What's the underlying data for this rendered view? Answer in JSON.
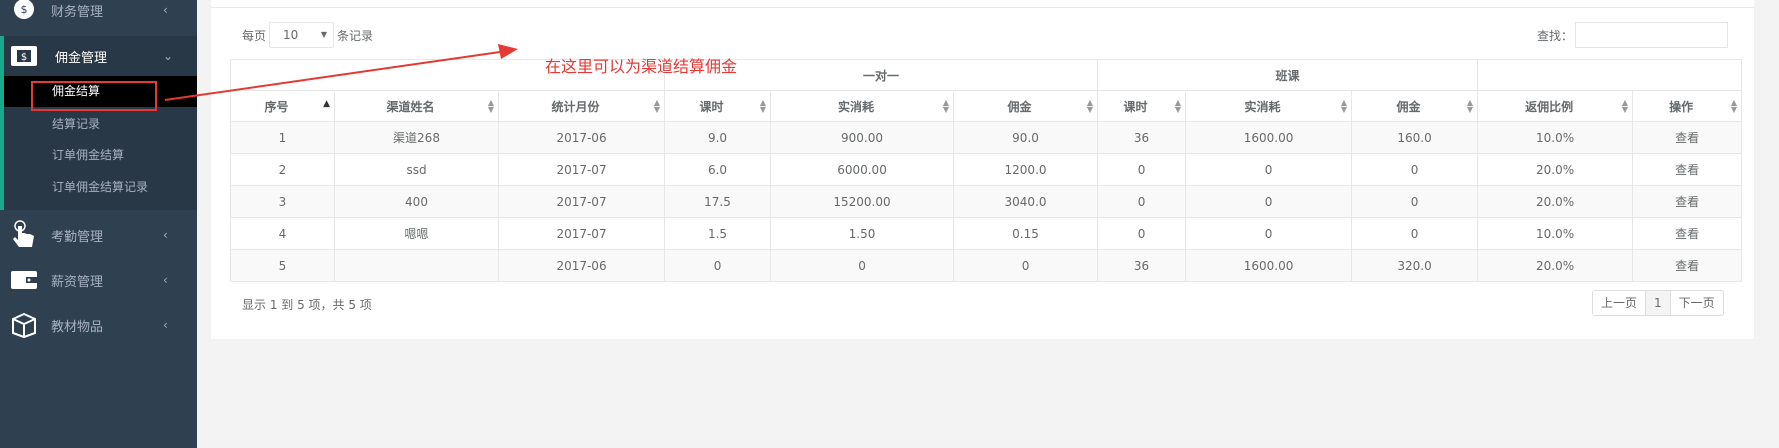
{
  "sidebar": {
    "items": [
      {
        "label": "财务管理",
        "icon": "money-bag-icon",
        "chevron": "‹"
      },
      {
        "label": "佣金管理",
        "icon": "dollar-card-icon",
        "chevron": "⌄"
      },
      {
        "label": "考勤管理",
        "icon": "hand-pointer-icon",
        "chevron": "‹"
      },
      {
        "label": "薪资管理",
        "icon": "wallet-icon",
        "chevron": "‹"
      },
      {
        "label": "教材物品",
        "icon": "package-icon",
        "chevron": "‹"
      }
    ],
    "submenu": [
      {
        "label": "佣金结算"
      },
      {
        "label": "结算记录"
      },
      {
        "label": "订单佣金结算"
      },
      {
        "label": "订单佣金结算记录"
      }
    ]
  },
  "controls": {
    "per_page_prefix": "每页",
    "per_page_value": "10",
    "per_page_suffix": "条记录",
    "search_label": "查找："
  },
  "table": {
    "groups": [
      "一对一",
      "班课"
    ],
    "headers": [
      "序号",
      "渠道姓名",
      "统计月份",
      "课时",
      "实消耗",
      "佣金",
      "课时",
      "实消耗",
      "佣金",
      "返佣比例",
      "操作"
    ],
    "rows": [
      [
        "1",
        "渠道268",
        "2017-06",
        "9.0",
        "900.00",
        "90.0",
        "36",
        "1600.00",
        "160.0",
        "10.0%",
        "查看"
      ],
      [
        "2",
        "ssd",
        "2017-07",
        "6.0",
        "6000.00",
        "1200.0",
        "0",
        "0",
        "0",
        "20.0%",
        "查看"
      ],
      [
        "3",
        "400",
        "2017-07",
        "17.5",
        "15200.00",
        "3040.0",
        "0",
        "0",
        "0",
        "20.0%",
        "查看"
      ],
      [
        "4",
        "嗯嗯",
        "2017-07",
        "1.5",
        "1.50",
        "0.15",
        "0",
        "0",
        "0",
        "10.0%",
        "查看"
      ],
      [
        "5",
        "",
        "2017-06",
        "0",
        "0",
        "0",
        "36",
        "1600.00",
        "320.0",
        "20.0%",
        "查看"
      ]
    ]
  },
  "footer": {
    "info": "显示 1 到 5 项，共 5 项",
    "prev": "上一页",
    "page": "1",
    "next": "下一页"
  },
  "annotation": {
    "text": "在这里可以为渠道结算佣金",
    "color": "#e53935"
  },
  "colors": {
    "sidebar_bg": "#2f4050",
    "accent": "#19aa8d",
    "link": "#337ab7"
  }
}
